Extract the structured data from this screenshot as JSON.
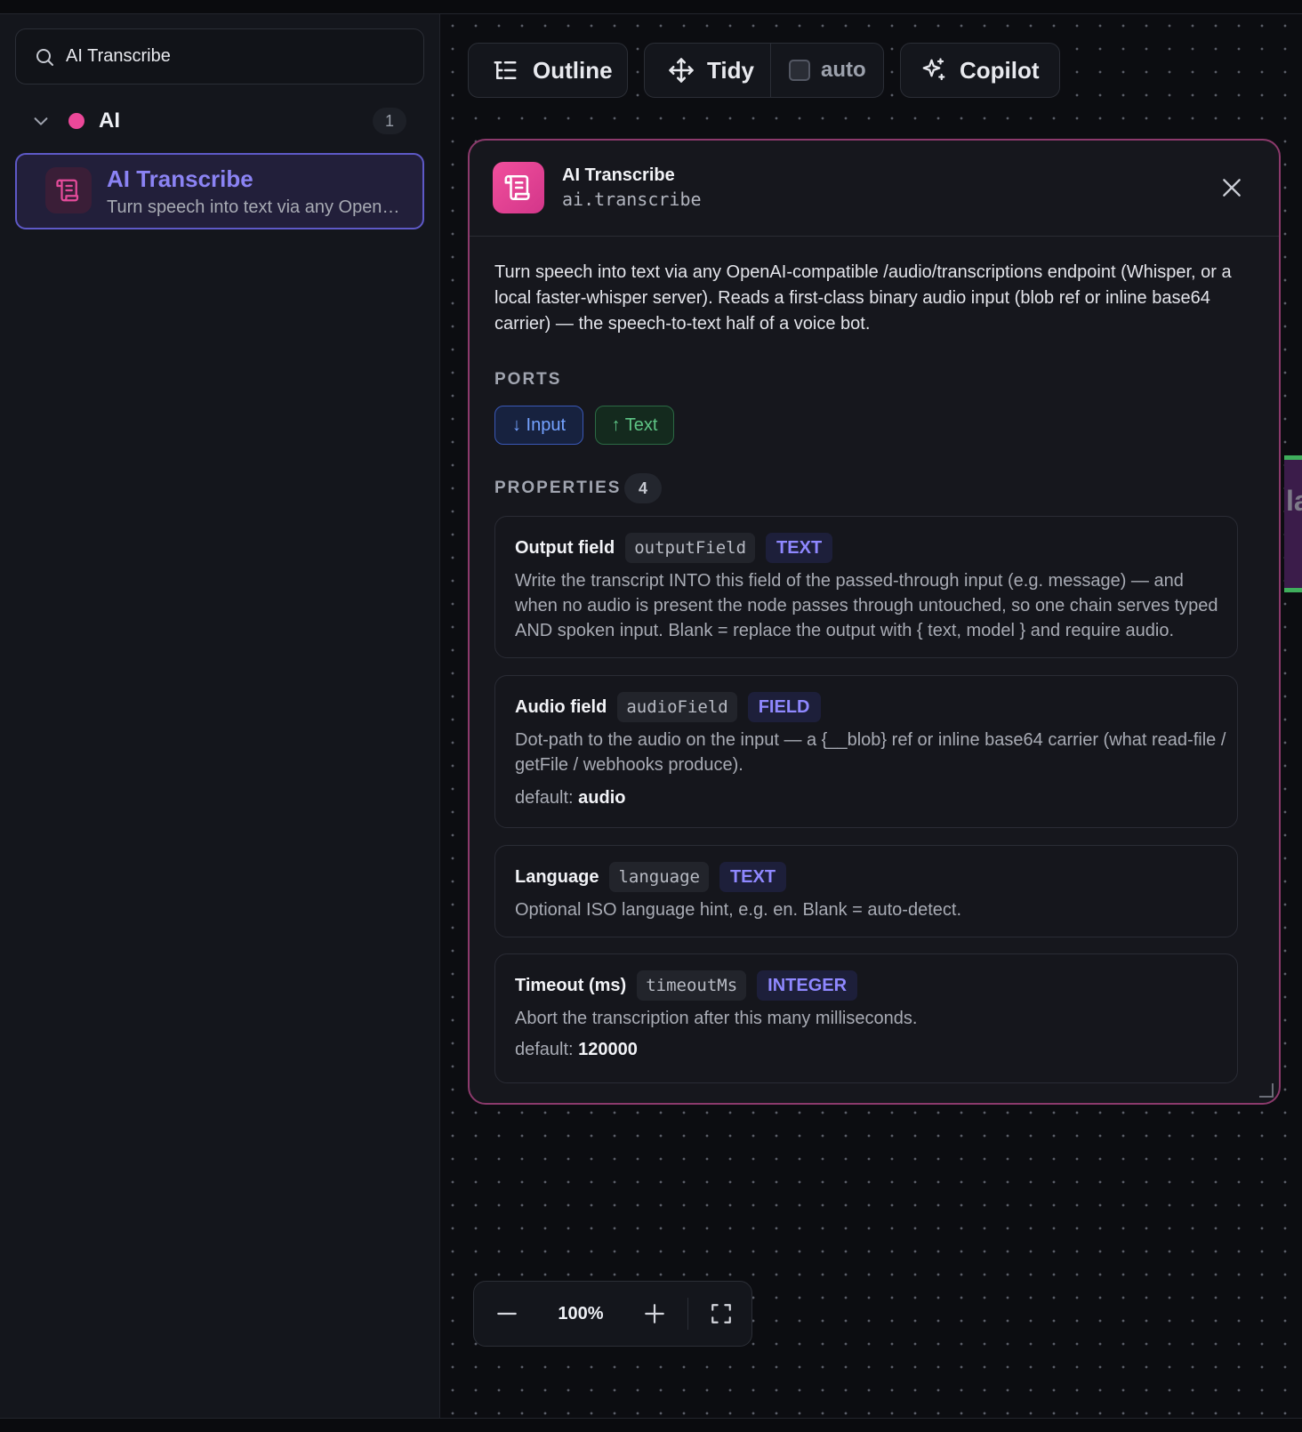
{
  "sidebar": {
    "search_value": "AI Transcribe",
    "category": {
      "label": "AI",
      "count": "1",
      "color": "#ec4899"
    },
    "node": {
      "title": "AI Transcribe",
      "description": "Turn speech into text via any OpenAI..."
    }
  },
  "toolbar": {
    "outline_label": "Outline",
    "tidy_label": "Tidy",
    "auto_label": "auto",
    "copilot_label": "Copilot"
  },
  "panel": {
    "name": "AI Transcribe",
    "type": "ai.transcribe",
    "description": "Turn speech into text via any OpenAI-compatible /audio/transcriptions endpoint (Whisper, or a local faster-whisper server). Reads a first-class binary audio input (blob ref or inline base64 carrier) — the speech-to-text half of a voice bot.",
    "ports_label": "PORTS",
    "ports": {
      "input_label": "↓ Input",
      "output_label": "↑ Text"
    },
    "properties_label": "PROPERTIES",
    "properties_count": "4",
    "properties": [
      {
        "label": "Output field",
        "key": "outputField",
        "type": "TEXT",
        "description": "Write the transcript INTO this field of the passed-through input (e.g. message) — and when no audio is present the node passes through untouched, so one chain serves typed AND spoken input. Blank = replace the output with { text, model } and require audio."
      },
      {
        "label": "Audio field",
        "key": "audioField",
        "type": "FIELD",
        "description": "Dot-path to the audio on the input — a {__blob} ref or inline base64 carrier (what read-file / getFile / webhooks produce).",
        "default_prefix": "default:",
        "default_value": "audio"
      },
      {
        "label": "Language",
        "key": "language",
        "type": "TEXT",
        "description": "Optional ISO language hint, e.g. en. Blank = auto-detect."
      },
      {
        "label": "Timeout (ms)",
        "key": "timeoutMs",
        "type": "INTEGER",
        "description": "Abort the transcription after this many milliseconds.",
        "default_prefix": "default:",
        "default_value": "120000"
      }
    ]
  },
  "canvas": {
    "edge_node_fragment": "la"
  },
  "zoom": {
    "level": "100%"
  },
  "colors": {
    "accent": "#8b83f4",
    "node_pink": "#ec4899",
    "port_in": "#74a2ff",
    "port_out": "#5ec485"
  }
}
